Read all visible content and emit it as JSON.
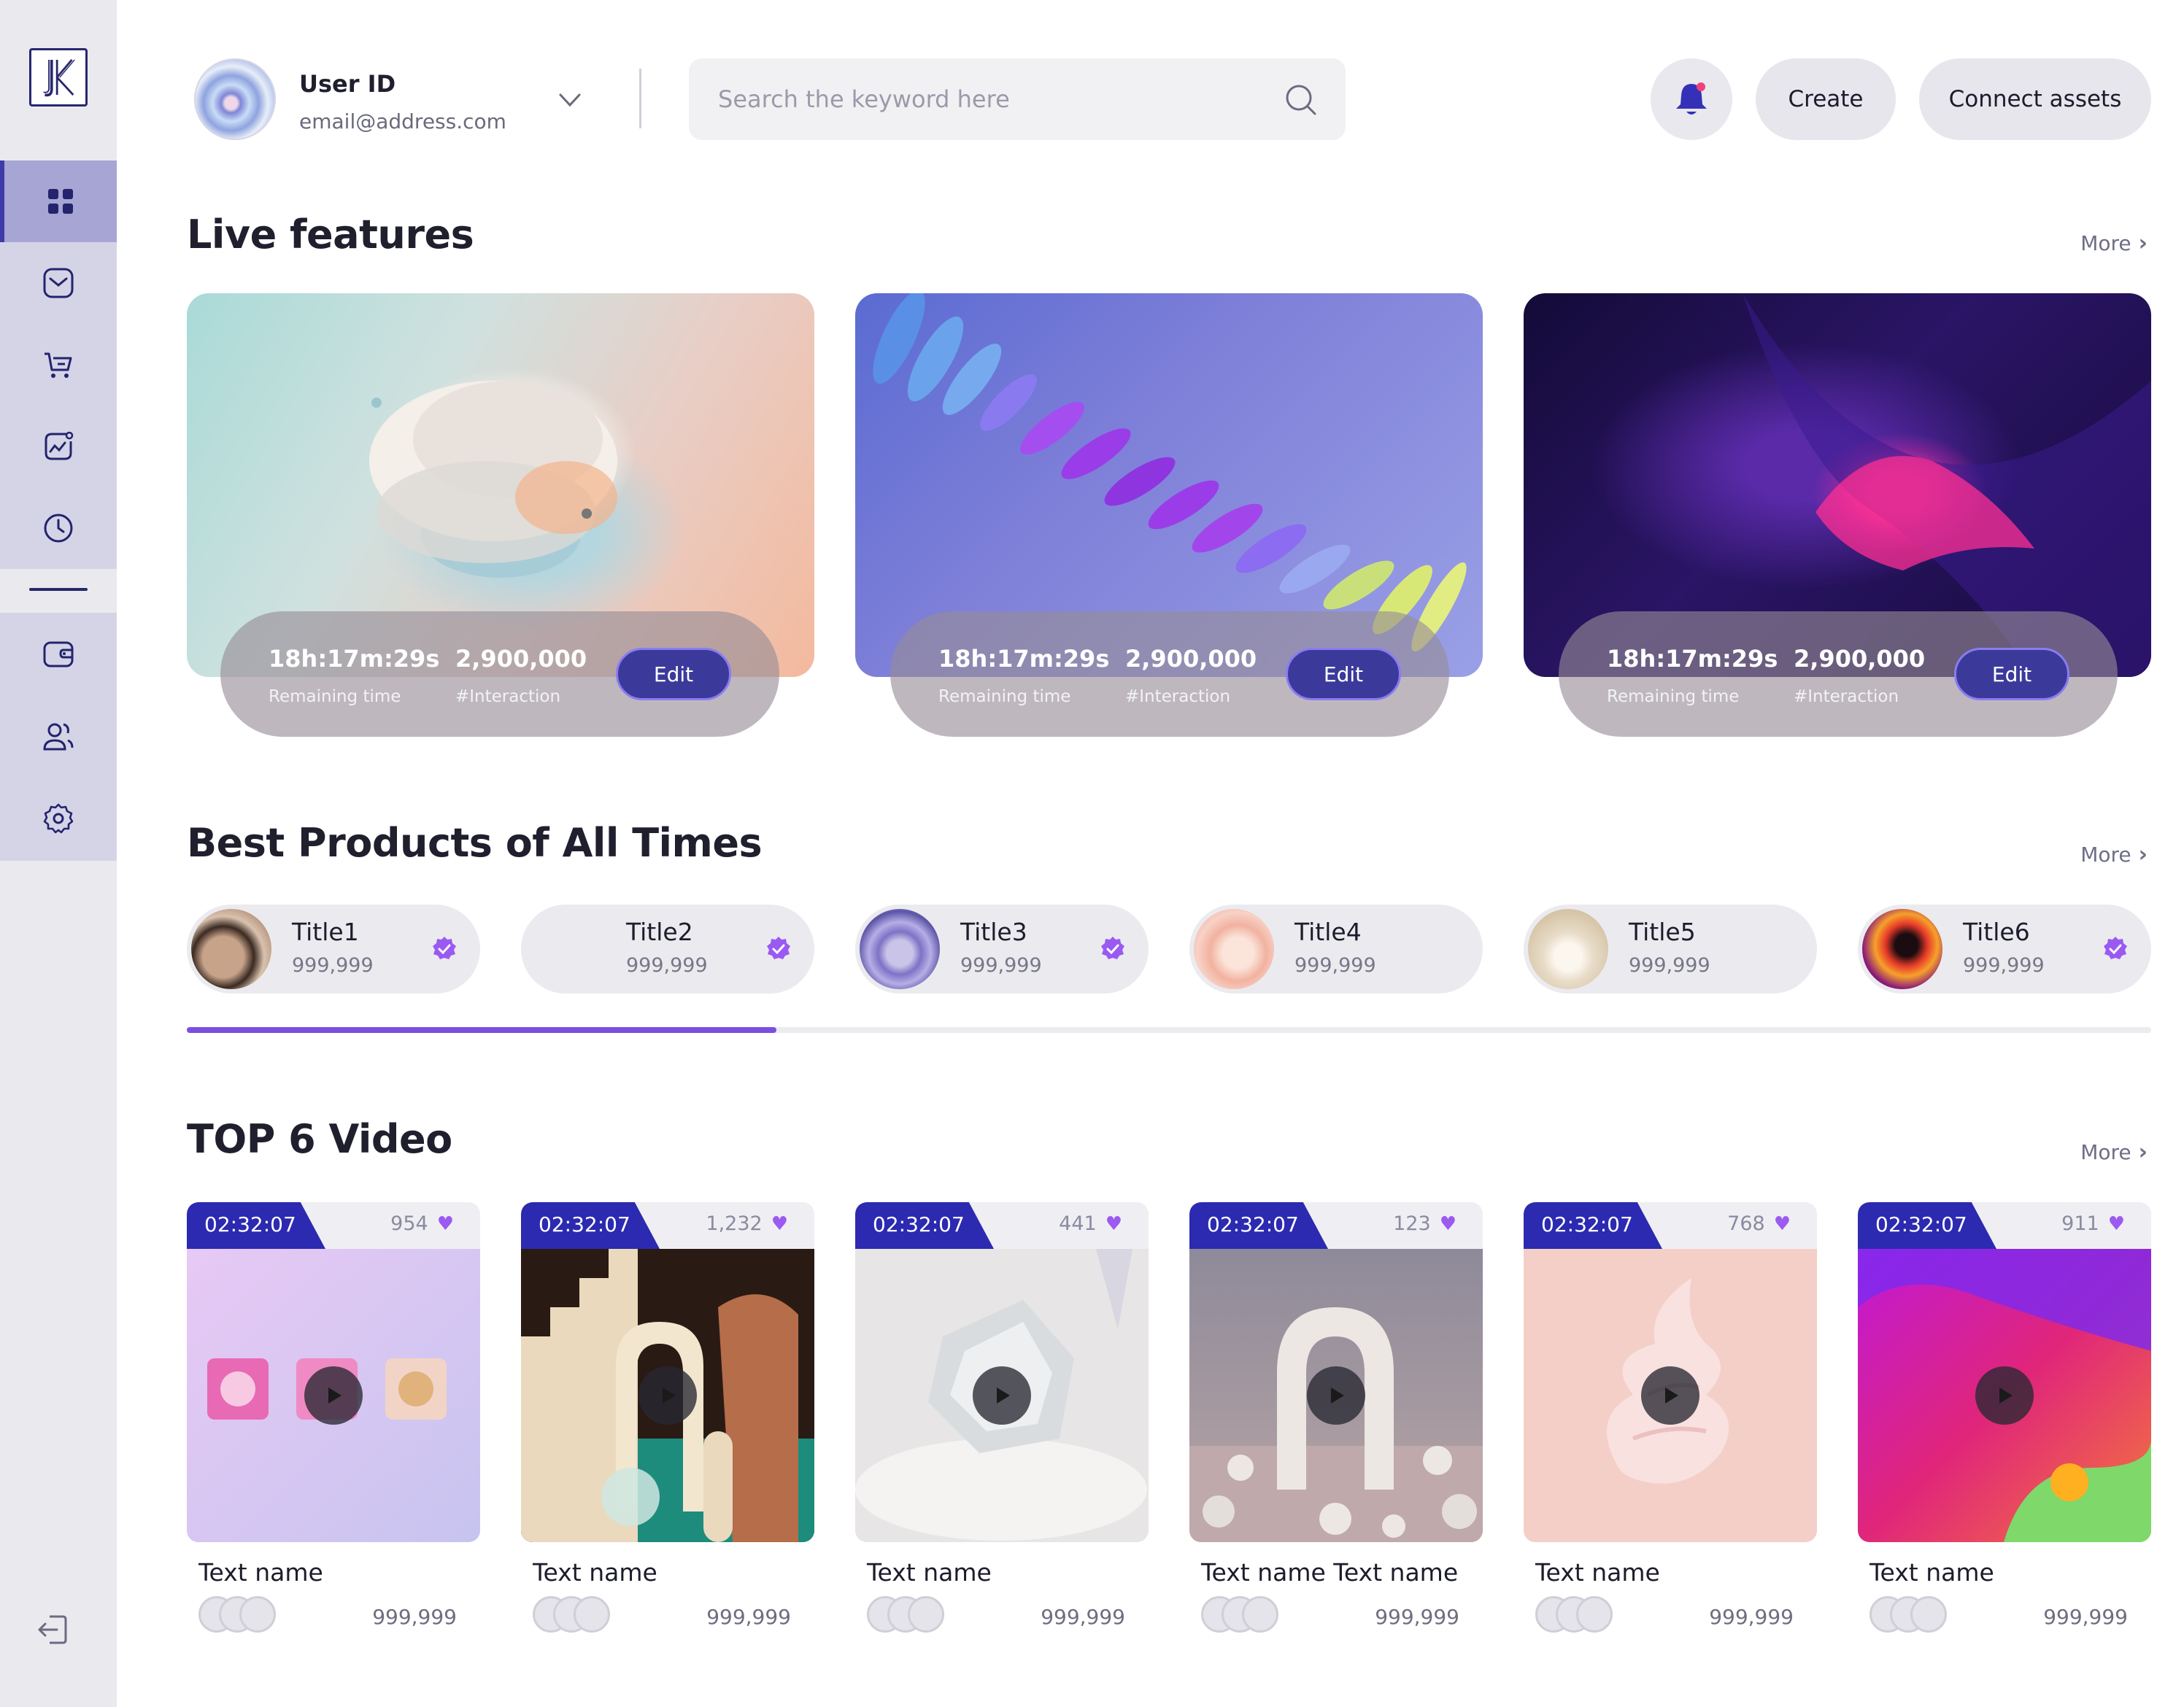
{
  "header": {
    "user_name": "User ID",
    "user_email": "email@address.com",
    "search_placeholder": "Search the keyword here",
    "create_label": "Create",
    "connect_label": "Connect assets"
  },
  "sidebar": {
    "items": [
      {
        "name": "dashboard",
        "icon": "grid-icon",
        "active": true
      },
      {
        "name": "messages",
        "icon": "mail-icon"
      },
      {
        "name": "cart",
        "icon": "cart-icon"
      },
      {
        "name": "analytics",
        "icon": "chart-icon"
      },
      {
        "name": "history",
        "icon": "clock-icon"
      },
      {
        "name": "wallet",
        "icon": "wallet-icon"
      },
      {
        "name": "users",
        "icon": "users-icon"
      },
      {
        "name": "settings",
        "icon": "gear-icon"
      }
    ],
    "logout_icon": "logout-icon"
  },
  "live": {
    "title": "Live features",
    "more": "More",
    "cards": [
      {
        "time": "18h:17m:29s",
        "time_label": "Remaining time",
        "count": "2,900,000",
        "count_label": "#Interaction",
        "edit": "Edit"
      },
      {
        "time": "18h:17m:29s",
        "time_label": "Remaining time",
        "count": "2,900,000",
        "count_label": "#Interaction",
        "edit": "Edit"
      },
      {
        "time": "18h:17m:29s",
        "time_label": "Remaining time",
        "count": "2,900,000",
        "count_label": "#Interaction",
        "edit": "Edit"
      }
    ]
  },
  "best": {
    "title": "Best Products of All Times",
    "more": "More",
    "scroll_progress": 0.3,
    "products": [
      {
        "title": "Title1",
        "value": "999,999",
        "verified": true
      },
      {
        "title": "Title2",
        "value": "999,999",
        "verified": true
      },
      {
        "title": "Title3",
        "value": "999,999",
        "verified": true
      },
      {
        "title": "Title4",
        "value": "999,999",
        "verified": false
      },
      {
        "title": "Title5",
        "value": "999,999",
        "verified": false
      },
      {
        "title": "Title6",
        "value": "999,999",
        "verified": true
      }
    ]
  },
  "videos": {
    "title": "TOP 6 Video",
    "more": "More",
    "items": [
      {
        "duration": "02:32:07",
        "likes": "954",
        "name": "Text name",
        "count": "999,999"
      },
      {
        "duration": "02:32:07",
        "likes": "1,232",
        "name": "Text name",
        "count": "999,999"
      },
      {
        "duration": "02:32:07",
        "likes": "441",
        "name": "Text name",
        "count": "999,999"
      },
      {
        "duration": "02:32:07",
        "likes": "123",
        "name": "Text name Text name",
        "count": "999,999"
      },
      {
        "duration": "02:32:07",
        "likes": "768",
        "name": "Text name",
        "count": "999,999"
      },
      {
        "duration": "02:32:07",
        "likes": "911",
        "name": "Text name",
        "count": "999,999"
      }
    ]
  },
  "colors": {
    "accent": "#3e3ba8",
    "tag": "#2c2ab0",
    "progress": "#7a4fe0",
    "heart": "#9b5af0"
  }
}
